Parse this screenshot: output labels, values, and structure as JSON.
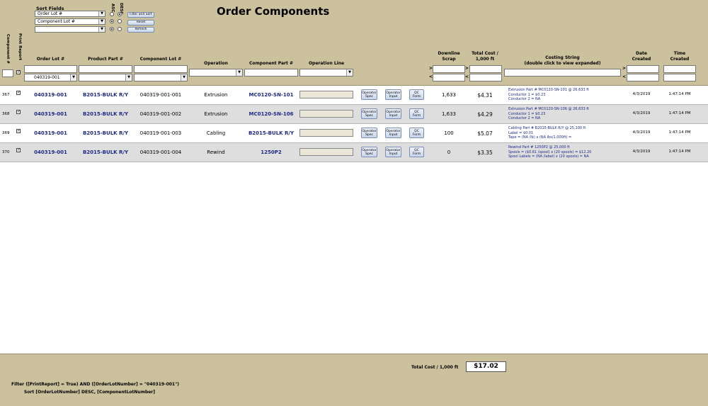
{
  "title": "Order Components",
  "sort": {
    "label": "Sort Fields",
    "fields": [
      "Order Lot #",
      "Component Lot #",
      ""
    ],
    "asc_label": "ASC",
    "desc_label": "DESC",
    "buttons": {
      "filter_sort": "Filter and Sort",
      "reset": "Reset",
      "refresh": "Refresh"
    }
  },
  "columns": {
    "component_num": "Component #",
    "print_report": "Print Report",
    "order_lot": "Order Lot #",
    "product_part": "Product Part #",
    "component_lot": "Component Lot #",
    "operation": "Operation",
    "component_part": "Component Part #",
    "operation_line": "Operation Line",
    "downline_scrap": "Downline\nScrap",
    "total_cost": "Total Cost /\n1,000 ft",
    "costing_string": "Costing String\n(double click to view expanded)",
    "date_created": "Date\nCreated",
    "time_created": "Time\nCreated"
  },
  "filters": {
    "order_lot_value": "040319-001",
    "gt": ">",
    "lt": "<"
  },
  "row_buttons": {
    "spec": "Operator\nSpec",
    "input": "Operator\nInput",
    "qc": "QC\nForm"
  },
  "rows": [
    {
      "num": "367",
      "order_lot": "040319-001",
      "product_part": "B2015-BULK R/Y",
      "component_lot": "040319-001-001",
      "operation": "Extrusion",
      "component_part": "MC0120-SN-101",
      "scrap": "1,633",
      "cost": "$4.31",
      "costing": [
        "Extrusion Part # MC0120-SN-101 @ 26,633 ft",
        "Conductor 1 = $0.23",
        "Conductor 2 = NA"
      ],
      "date": "4/3/2019",
      "time": "1:47:14 PM"
    },
    {
      "num": "368",
      "order_lot": "040319-001",
      "product_part": "B2015-BULK R/Y",
      "component_lot": "040319-001-002",
      "operation": "Extrusion",
      "component_part": "MC0120-SN-106",
      "scrap": "1,633",
      "cost": "$4.29",
      "costing": [
        "Extrusion Part # MC0120-SN-106 @ 26,633 ft",
        "Conductor 1 = $0.23",
        "Conductor 2 = NA"
      ],
      "date": "4/3/2019",
      "time": "1:47:14 PM"
    },
    {
      "num": "369",
      "order_lot": "040319-001",
      "product_part": "B2015-BULK R/Y",
      "component_lot": "040319-001-003",
      "operation": "Cabling",
      "component_part": "B2015-BULK R/Y",
      "scrap": "100",
      "cost": "$5.07",
      "costing": [
        "Cabling Part # B2015-BULK R/Y @ 25,100 ft",
        "Label = $0.01",
        "Tape = (NA /lb) x (NA lbs/1,000ft) ="
      ],
      "date": "4/3/2019",
      "time": "1:47:14 PM"
    },
    {
      "num": "370",
      "order_lot": "040319-001",
      "product_part": "B2015-BULK R/Y",
      "component_lot": "040319-001-004",
      "operation": "Rewind",
      "component_part": "1250P2",
      "scrap": "0",
      "cost": "$3.35",
      "costing": [
        "Rewind Part # 1250P2 @ 25,000 ft",
        "Spools = ($0.61 /spool) x (20 spools) = $12.20",
        "Spool Labels = (NA /label) x (20 spools) = NA"
      ],
      "date": "4/3/2019",
      "time": "1:47:14 PM"
    }
  ],
  "footer": {
    "total_label": "Total Cost / 1,000 ft",
    "total_value": "$17.02",
    "filter_text": "Filter ([PrintReport] = True) AND ([OrderLotNumber] = \"040319-001\")",
    "sort_text": "Sort [OrderLotNumber] DESC, [ComponentLotNumber]"
  }
}
